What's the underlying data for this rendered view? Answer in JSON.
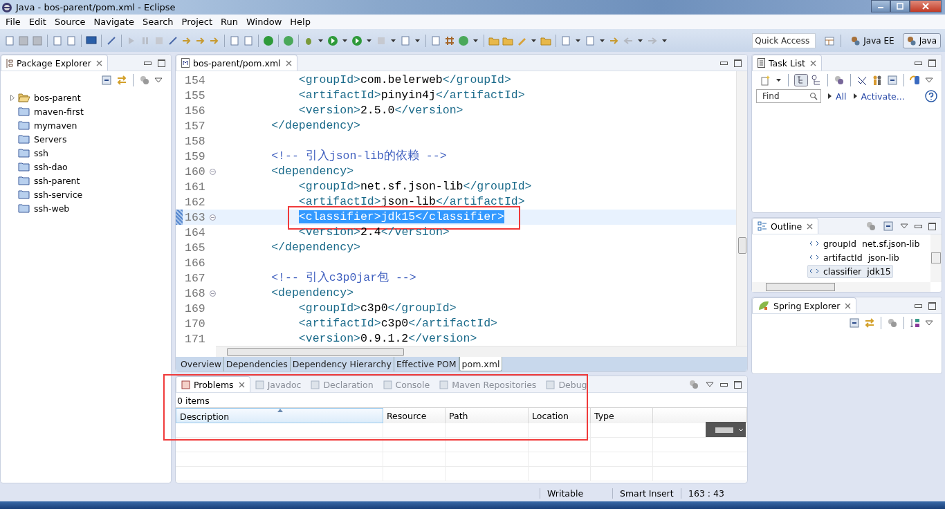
{
  "window": {
    "title": "Java - bos-parent/pom.xml - Eclipse"
  },
  "menu": [
    "File",
    "Edit",
    "Source",
    "Navigate",
    "Search",
    "Project",
    "Run",
    "Window",
    "Help"
  ],
  "quick_access": {
    "placeholder": "Quick Access"
  },
  "perspectives": [
    {
      "label": "Java EE",
      "selected": false
    },
    {
      "label": "Java",
      "selected": true
    }
  ],
  "package_explorer": {
    "title": "Package Explorer",
    "items": [
      {
        "label": "bos-parent",
        "kind": "maven"
      },
      {
        "label": "maven-first",
        "kind": "folder"
      },
      {
        "label": "mymaven",
        "kind": "folder"
      },
      {
        "label": "Servers",
        "kind": "folder"
      },
      {
        "label": "ssh",
        "kind": "folder"
      },
      {
        "label": "ssh-dao",
        "kind": "folder"
      },
      {
        "label": "ssh-parent",
        "kind": "folder"
      },
      {
        "label": "ssh-service",
        "kind": "folder"
      },
      {
        "label": "ssh-web",
        "kind": "folder"
      }
    ]
  },
  "editor": {
    "tab": "bos-parent/pom.xml",
    "lines": [
      {
        "num": "154",
        "kind": "code",
        "text": "            <groupId>com.belerweb</groupId>",
        "selected": false
      },
      {
        "num": "155",
        "kind": "code",
        "text": "            <artifactId>pinyin4j</artifactId>",
        "selected": false
      },
      {
        "num": "156",
        "kind": "code",
        "text": "            <version>2.5.0</version>",
        "selected": false
      },
      {
        "num": "157",
        "kind": "code",
        "text": "        </dependency>",
        "selected": false
      },
      {
        "num": "158",
        "selected": false
      },
      {
        "num": "159",
        "kind": "comment",
        "text": "        <!-- 引入json-lib的依赖 -->",
        "selected": false
      },
      {
        "num": "160",
        "kind": "code",
        "text": "        <dependency>",
        "fold": true,
        "selected": false
      },
      {
        "num": "161",
        "kind": "code",
        "text": "            <groupId>net.sf.json-lib</groupId>",
        "selected": false
      },
      {
        "num": "162",
        "kind": "code",
        "text": "            <artifactId>json-lib</artifactId>",
        "selected": false
      },
      {
        "num": "163",
        "kind": "code",
        "text": "            <classifier>jdk15</classifier>",
        "fold": true,
        "selected": true,
        "boxed": true
      },
      {
        "num": "164",
        "kind": "code",
        "text": "            <version>2.4</version>",
        "selected": false
      },
      {
        "num": "165",
        "kind": "code",
        "text": "        </dependency>",
        "selected": false
      },
      {
        "num": "166",
        "selected": false
      },
      {
        "num": "167",
        "kind": "comment",
        "text": "        <!-- 引入c3p0jar包 -->",
        "selected": false
      },
      {
        "num": "168",
        "kind": "code",
        "text": "        <dependency>",
        "fold": true,
        "selected": false
      },
      {
        "num": "169",
        "kind": "code",
        "text": "            <groupId>c3p0</groupId>",
        "selected": false
      },
      {
        "num": "170",
        "kind": "code",
        "text": "            <artifactId>c3p0</artifactId>",
        "selected": false
      },
      {
        "num": "171",
        "kind": "code",
        "text": "            <version>0.9.1.2</version>",
        "selected": false
      }
    ],
    "bottom_tabs": [
      {
        "label": "Overview",
        "selected": false
      },
      {
        "label": "Dependencies",
        "selected": false
      },
      {
        "label": "Dependency Hierarchy",
        "selected": false
      },
      {
        "label": "Effective POM",
        "selected": false
      },
      {
        "label": "pom.xml",
        "selected": true
      }
    ]
  },
  "task_list": {
    "title": "Task List",
    "find": {
      "placeholder": "Find"
    },
    "links": [
      "All",
      "Activate..."
    ]
  },
  "outline": {
    "title": "Outline",
    "items": [
      {
        "tag": "groupId",
        "value": "net.sf.json-lib",
        "selected": false
      },
      {
        "tag": "artifactId",
        "value": "json-lib",
        "selected": false
      },
      {
        "tag": "classifier",
        "value": "jdk15",
        "selected": true
      }
    ]
  },
  "spring_explorer": {
    "title": "Spring Explorer"
  },
  "problems": {
    "boxed": true,
    "tabs": [
      {
        "label": "Problems",
        "selected": true
      },
      {
        "label": "Javadoc",
        "selected": false
      },
      {
        "label": "Declaration",
        "selected": false
      },
      {
        "label": "Console",
        "selected": false
      },
      {
        "label": "Maven Repositories",
        "selected": false
      },
      {
        "label": "Debug",
        "selected": false
      }
    ],
    "count": "0 items",
    "columns": [
      {
        "label": "Description",
        "sorted": true
      },
      {
        "label": "Resource",
        "sorted": false
      },
      {
        "label": "Path",
        "sorted": false
      },
      {
        "label": "Location",
        "sorted": false
      },
      {
        "label": "Type",
        "sorted": false
      }
    ]
  },
  "status_bar": [
    "Writable",
    "Smart Insert",
    "163 : 43"
  ]
}
